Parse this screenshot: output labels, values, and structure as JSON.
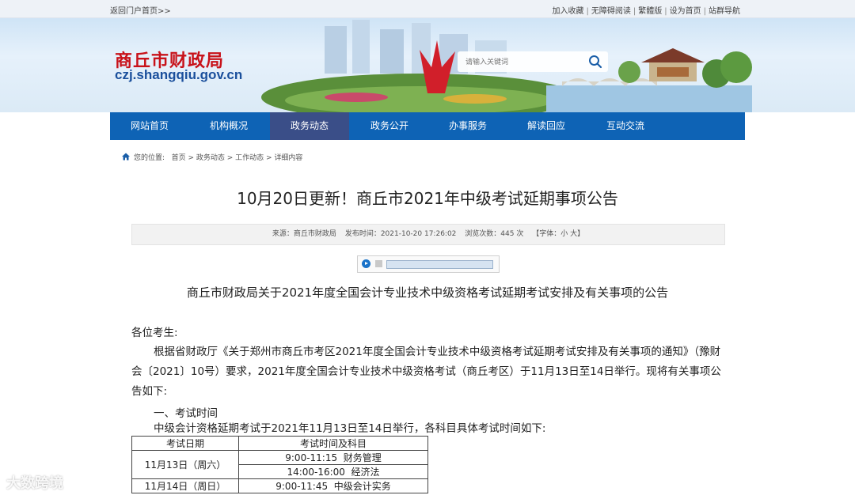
{
  "topbar": {
    "portal_link": "返回门户首页>>",
    "links": [
      "加入收藏",
      "无障碍阅读",
      "繁體版",
      "设为首页",
      "站群导航"
    ]
  },
  "banner": {
    "logo_cn": "商丘市财政局",
    "logo_en": "czj.shangqiu.gov.cn",
    "search_placeholder": "请输入关键词",
    "icons": {
      "search": "search-icon"
    }
  },
  "nav": {
    "items": [
      "网站首页",
      "机构概况",
      "政务动态",
      "政务公开",
      "办事服务",
      "解读回应",
      "互动交流"
    ],
    "active": "政务动态",
    "active_color": "#3a4e88",
    "bg_color": "#0e63b5"
  },
  "breadcrumb": {
    "label": "您的位置:",
    "path": "首页 > 政务动态 > 工作动态 > 详细内容"
  },
  "article": {
    "title": "10月20日更新！商丘市2021年中级考试延期事项公告",
    "meta": {
      "source": "来源：商丘市财政局",
      "published": "发布时间：2021-10-20 17:26:02",
      "views": "浏览次数：445 次",
      "font_size": "【字体：小 大】"
    },
    "subtitle": "商丘市财政局关于2021年度全国会计专业技术中级资格考试延期考试安排及有关事项的公告",
    "greeting": "各位考生:",
    "body": "根据省财政厅《关于郑州市商丘市考区2021年度全国会计专业技术中级资格考试延期考试安排及有关事项的通知》（豫财会〔2021〕10号）要求，2021年度全国会计专业技术中级资格考试（商丘考区）于11月13日至14日举行。现将有关事项公告如下:",
    "section1_title": "一、考试时间",
    "section1_text": "中级会计资格延期考试于2021年11月13日至14日举行，各科目具体考试时间如下:",
    "table": {
      "headers": [
        "考试日期",
        "考试时间及科目"
      ],
      "rows": [
        {
          "date": "11月13日（周六）",
          "sessions": [
            "9:00-11:15  财务管理",
            "14:00-16:00  经济法"
          ]
        },
        {
          "date": "11月14日（周日）",
          "sessions": [
            "9:00-11:45  中级会计实务"
          ]
        }
      ]
    }
  },
  "watermark": "大数跨境"
}
